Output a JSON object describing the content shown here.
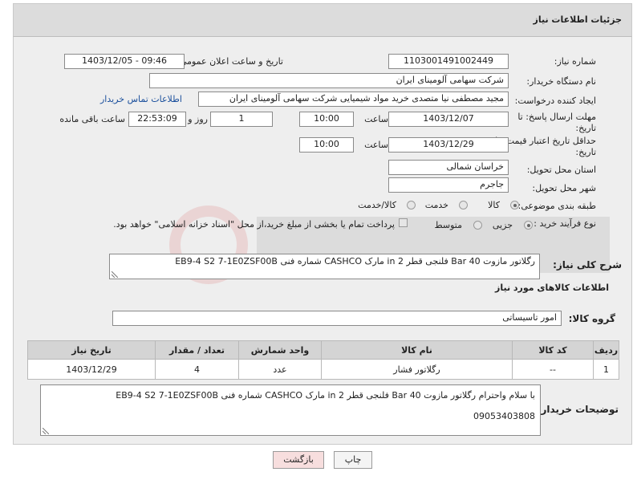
{
  "header": {
    "title": "جزئیات اطلاعات نیاز"
  },
  "form": {
    "need_number": {
      "label": "شماره نیاز:",
      "value": "1103001491002449"
    },
    "announce_datetime": {
      "label": "تاریخ و ساعت اعلان عمومی:",
      "value": "1403/12/05 - 09:46"
    },
    "buyer_org": {
      "label": "نام دستگاه خریدار:",
      "value": "شرکت سهامی آلومینای ایران"
    },
    "requester": {
      "label": "ایجاد کننده درخواست:",
      "value": "مجید مصطفی نیا متصدی خرید مواد شیمیایی شرکت سهامی آلومینای ایران",
      "contact_link": "اطلاعات تماس خریدار"
    },
    "reply_deadline": {
      "label": "مهلت ارسال پاسخ: تا تاریخ:",
      "date": "1403/12/07",
      "time_label": "ساعت",
      "time": "10:00",
      "days": "1",
      "days_label": "روز و",
      "remaining": "22:53:09",
      "remaining_label": "ساعت باقی مانده"
    },
    "price_validity": {
      "label": "حداقل تاریخ اعتبار قیمت: تا تاریخ:",
      "date": "1403/12/29",
      "time_label": "ساعت",
      "time": "10:00"
    },
    "province": {
      "label": "استان محل تحویل:",
      "value": "خراسان شمالی"
    },
    "city": {
      "label": "شهر محل تحویل:",
      "value": "جاجرم"
    },
    "category": {
      "label": "طبقه بندی موضوعی:",
      "options": [
        "کالا",
        "خدمت",
        "کالا/خدمت"
      ]
    },
    "purchase_type": {
      "label": "نوع فرآیند خرید :",
      "options": [
        "جزیی",
        "متوسط"
      ],
      "payment_note": "پرداخت تمام یا بخشی از مبلغ خرید،از محل \"اسناد خزانه اسلامی\" خواهد بود."
    }
  },
  "summary": {
    "label": "شرح کلی نیاز:",
    "value": "رگلاتور مازوت 40 Bar فلنجی قطر 2 in مارک CASHCO شماره فنی EB9-4 S2 7-1E0ZSF00B"
  },
  "goods_section": {
    "title": "اطلاعات کالاهای مورد نیاز",
    "group_label": "گروه کالا:",
    "group_value": "امور تاسیساتی"
  },
  "table": {
    "headers": [
      "ردیف",
      "کد کالا",
      "نام کالا",
      "واحد شمارش",
      "تعداد / مقدار",
      "تاریخ نیاز"
    ],
    "rows": [
      [
        "1",
        "--",
        "رگلاتور فشار",
        "عدد",
        "4",
        "1403/12/29"
      ]
    ]
  },
  "buyer_notes": {
    "label": "توضیحات خریدار:",
    "line1": "با سلام واحترام رگلاتور مازوت 40 Bar فلنجی قطر 2 in مارک CASHCO شماره فنی EB9-4 S2 7-1E0ZSF00B",
    "line2": "09053403808"
  },
  "buttons": {
    "print": "چاپ",
    "back": "بازگشت"
  },
  "colors": {
    "header_bg": "#dcdcdc",
    "panel_bg": "#eeeeee",
    "link": "#1a4f9c",
    "back_button_bg": "#f7dede"
  }
}
